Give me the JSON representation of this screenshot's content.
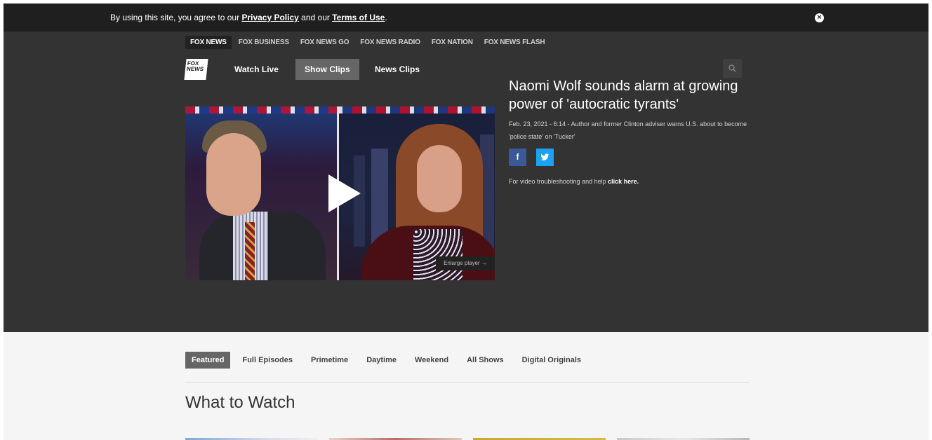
{
  "cookie_bar": {
    "prefix": "By using this site, you agree to our ",
    "privacy_link": "Privacy Policy",
    "middle": " and our ",
    "terms_link": "Terms of Use",
    "suffix": "."
  },
  "network_bar": {
    "items": [
      "FOX NEWS",
      "FOX BUSINESS",
      "FOX NEWS GO",
      "FOX NEWS RADIO",
      "FOX NATION",
      "FOX NEWS FLASH"
    ]
  },
  "logo": {
    "line1": "FOX",
    "line2": "NEWS"
  },
  "main_nav": {
    "items": [
      "Watch Live",
      "Show Clips",
      "News Clips"
    ],
    "active": "Show Clips"
  },
  "video": {
    "title": "Naomi Wolf sounds alarm at growing power of 'autocratic tyrants'",
    "description": "Feb. 23, 2021 - 6:14 - Author and former Clinton adviser warns U.S. about to become 'police state' on 'Tucker'",
    "enlarge_label": "Enlarge player →",
    "help_text": "For video troubleshooting and help ",
    "help_link": "click here.",
    "share_facebook": "f"
  },
  "tabs": {
    "items": [
      "Featured",
      "Full Episodes",
      "Primetime",
      "Daytime",
      "Weekend",
      "All Shows",
      "Digital Originals"
    ],
    "active": "Featured"
  },
  "section": {
    "title": "What to Watch"
  },
  "colors": {
    "header_bg": "#333333",
    "cookie_bg": "#1f1f1f",
    "active_nav": "#666666",
    "facebook": "#3b5998",
    "twitter": "#1da1f2"
  }
}
